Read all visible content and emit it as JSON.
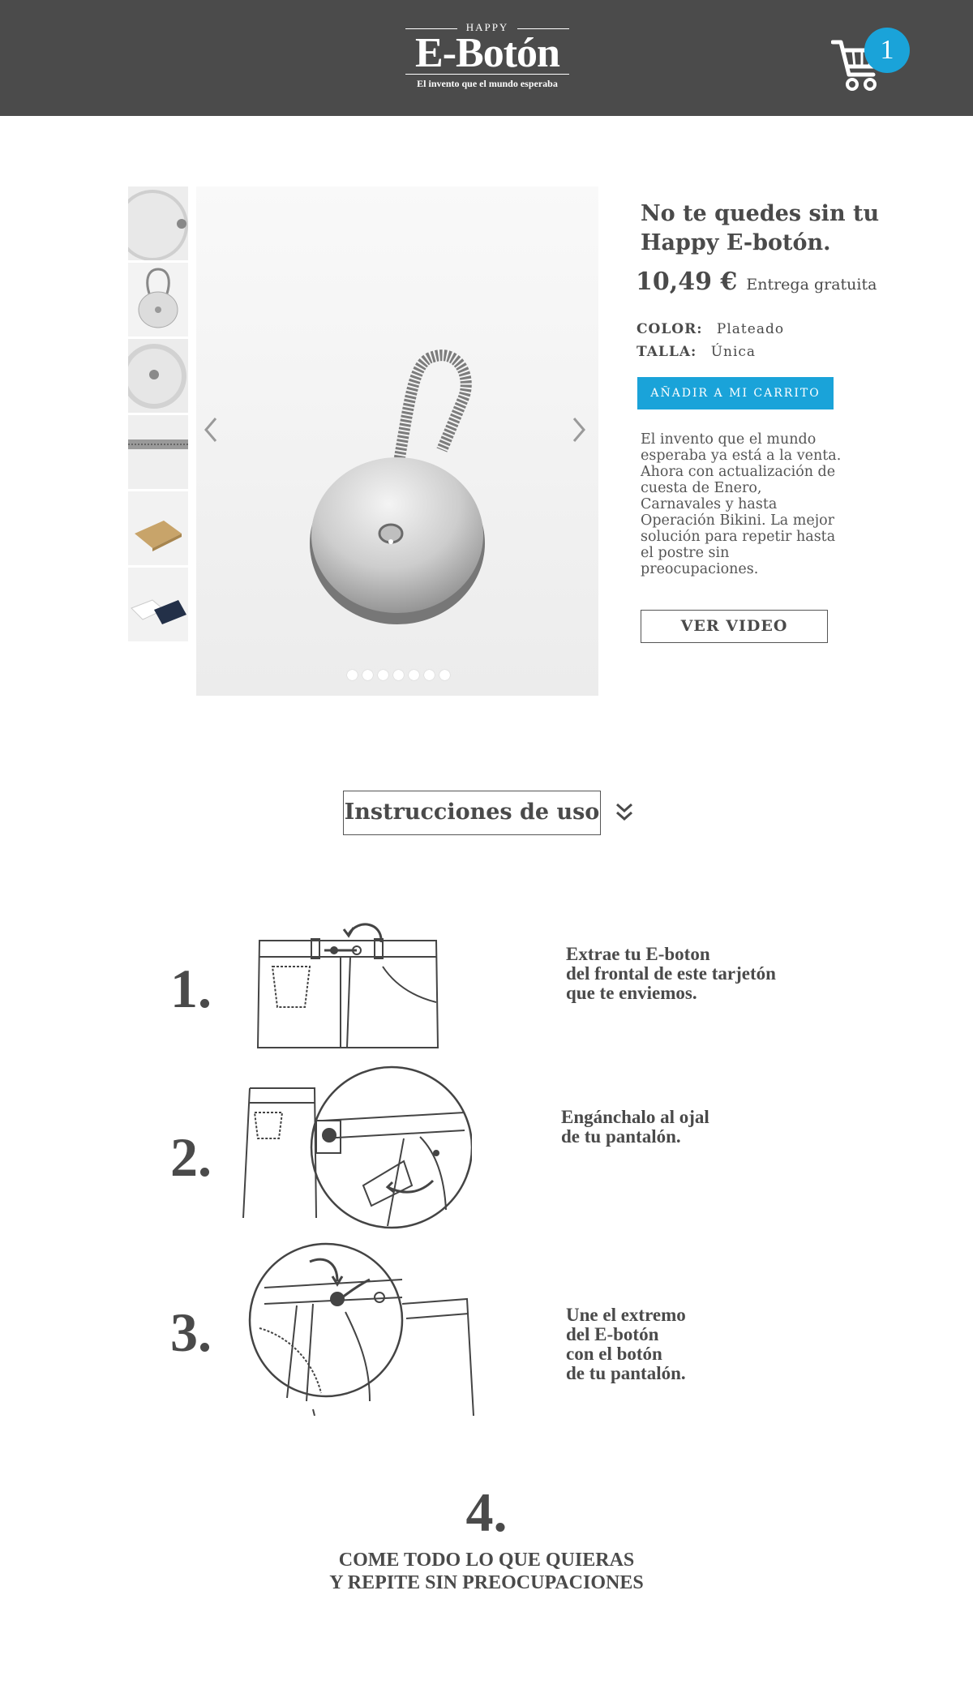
{
  "header": {
    "logo_top": "HAPPY",
    "logo_main": "E-Botón",
    "logo_tagline": "El invento que el mundo esperaba",
    "cart_count": "1",
    "cart_icon": "shopping-cart-icon",
    "background": "#4b4b4b",
    "accent": "#1aa3d9"
  },
  "gallery": {
    "thumbnail_count": 6,
    "slide_count": 7,
    "prev_icon": "chevron-left-icon",
    "next_icon": "chevron-right-icon"
  },
  "product": {
    "title": "No te quedes sin tu Happy E-botón.",
    "price": "10,49 €",
    "delivery": "Entrega gratuita",
    "color_label": "COLOR:",
    "color_value": "Plateado",
    "size_label": "TALLA:",
    "size_value": "Única",
    "add_to_cart": "AÑADIR A MI CARRITO",
    "description": "El invento que el mundo esperaba ya está a la venta. Ahora con actualización de cuesta de Enero, Carnavales y hasta Operación Bikini. La mejor solución para repetir hasta el postre sin preocupaciones.",
    "video_button": "VER VIDEO"
  },
  "instructions": {
    "title": "Instrucciones de uso",
    "expand_icon": "double-chevron-down-icon",
    "steps": [
      {
        "number": "1.",
        "text": "Extrae tu E-boton\ndel frontal de este tarjetón\nque te enviemos."
      },
      {
        "number": "2.",
        "text": "Engánchalo al ojal\nde tu pantalón."
      },
      {
        "number": "3.",
        "text": "Une el extremo\ndel E-botón\ncon el botón\nde tu pantalón."
      },
      {
        "number": "4.",
        "text": "COME TODO LO QUE QUIERAS\nY REPITE SIN PREOCUPACIONES"
      }
    ]
  }
}
